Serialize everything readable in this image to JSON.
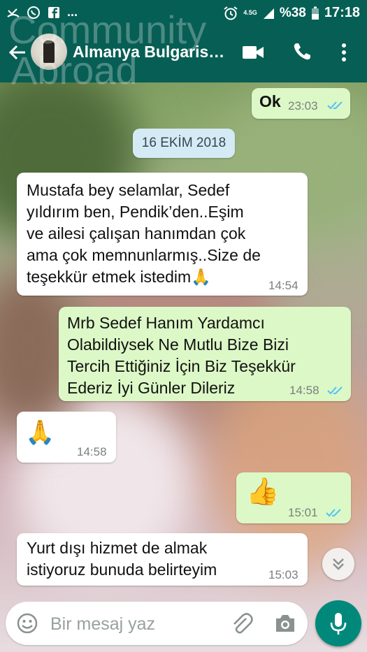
{
  "status_bar": {
    "battery_percent": "%38",
    "time": "17:18",
    "network": "4.5G",
    "left_dots": "..."
  },
  "header": {
    "chat_title": "Almanya Bulgaris…",
    "watermark_line1": "Community",
    "watermark_line2": "Abroad"
  },
  "date_label": "16 EKİM 2018",
  "messages": [
    {
      "direction": "out",
      "text": "Ok",
      "time": "23:03",
      "read": true
    },
    {
      "direction": "in",
      "lines": [
        "Mustafa bey selamlar, Sedef",
        "yıldırım ben, Pendik’den..Eşim",
        "ve ailesi çalışan hanımdan çok",
        "ama çok memnunlarmış..Size de",
        "teşekkür etmek istedim🙏"
      ],
      "time": "14:54"
    },
    {
      "direction": "out",
      "lines": [
        "Mrb Sedef Hanım Yardamcı",
        "Olabildiysek Ne Mutlu Bize Bizi",
        "Tercih Ettiğiniz İçin Biz Teşekkür",
        "Ederiz İyi Günler Dileriz"
      ],
      "time": "14:58",
      "read": true
    },
    {
      "direction": "in",
      "emoji": "🙏",
      "time": "14:58"
    },
    {
      "direction": "out",
      "emoji": "👍",
      "time": "15:01",
      "read": true
    },
    {
      "direction": "in",
      "lines": [
        "Yurt dışı hizmet de almak",
        "istiyoruz bunuda belirteyim"
      ],
      "time": "15:03"
    }
  ],
  "composer": {
    "placeholder": "Bir mesaj yaz",
    "value": ""
  },
  "icons": {
    "back": "arrow-left-icon",
    "video": "video-call-icon",
    "call": "phone-icon",
    "menu": "more-vert-icon",
    "emoji": "emoji-icon",
    "attach": "paperclip-icon",
    "camera": "camera-icon",
    "mic": "microphone-icon",
    "scroll": "double-chevron-down-icon"
  },
  "colors": {
    "header": "#075e54",
    "outgoing_bubble": "#dcf8c6",
    "incoming_bubble": "#ffffff",
    "read_ticks": "#4fc3f7",
    "mic_button": "#00897b"
  }
}
